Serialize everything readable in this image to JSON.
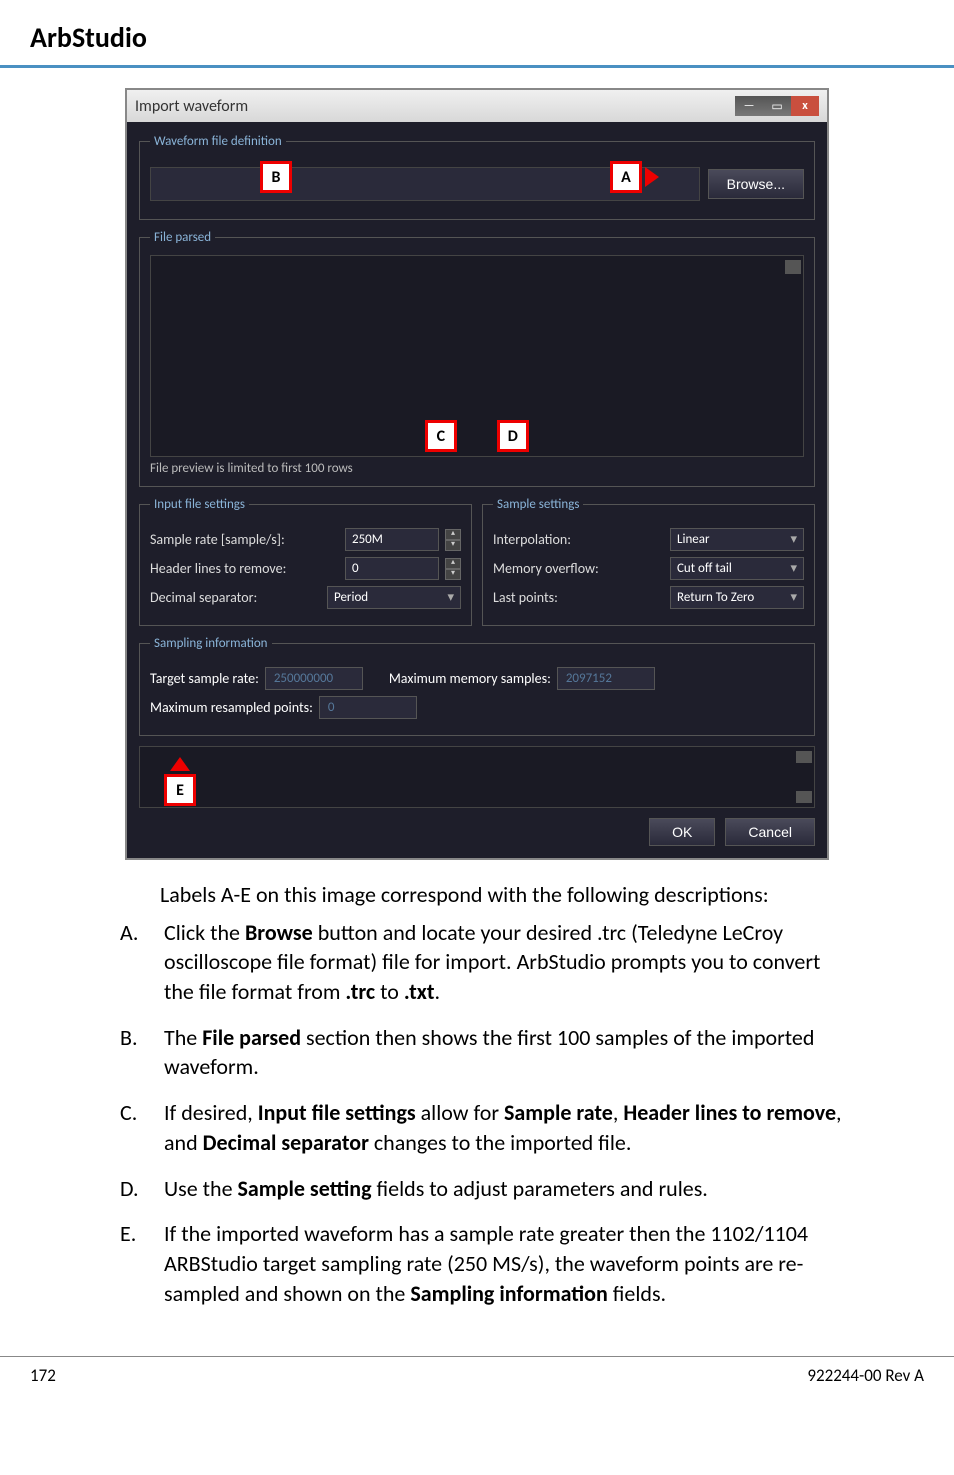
{
  "page_title": "ArbStudio",
  "window": {
    "title": "Import waveform",
    "close_x": "x"
  },
  "waveform_def": {
    "legend": "Waveform file definition",
    "browse": "Browse...",
    "marker_a": "A",
    "marker_b": "B"
  },
  "file_parsed": {
    "legend": "File parsed",
    "note": "File preview is limited to first 100 rows",
    "marker_c": "C",
    "marker_d": "D"
  },
  "input_settings": {
    "legend": "Input file settings",
    "sample_rate_label": "Sample rate [sample/s]:",
    "sample_rate_value": "250M",
    "header_lines_label": "Header lines to remove:",
    "header_lines_value": "0",
    "decimal_sep_label": "Decimal separator:",
    "decimal_sep_value": "Period"
  },
  "sample_settings": {
    "legend": "Sample settings",
    "interp_label": "Interpolation:",
    "interp_value": "Linear",
    "overflow_label": "Memory overflow:",
    "overflow_value": "Cut off tail",
    "lastpts_label": "Last points:",
    "lastpts_value": "Return To Zero"
  },
  "sampling_info": {
    "legend": "Sampling information",
    "target_rate_label": "Target sample rate:",
    "target_rate_value": "250000000",
    "max_mem_label": "Maximum memory samples:",
    "max_mem_value": "2097152",
    "max_resampled_label": "Maximum resampled points:",
    "max_resampled_value": "0"
  },
  "marker_e": "E",
  "ok": "OK",
  "cancel": "Cancel",
  "caption": "Labels A-E on this image correspond with the following descriptions:",
  "items": {
    "a_letter": "A.",
    "a_pre": "Click the ",
    "a_bold": "Browse",
    "a_post": " button and locate your desired .trc (Teledyne LeCroy oscilloscope file format) file for import. ArbStudio prompts you to convert the file format from ",
    "a_b1": ".trc",
    "a_mid": " to ",
    "a_b2": ".txt",
    "a_end": ".",
    "b_letter": "B.",
    "b_pre": "The ",
    "b_bold": "File parsed",
    "b_post": " section then shows the first 100 samples of the imported waveform.",
    "c_letter": "C.",
    "c_pre": "If desired, ",
    "c_b1": "Input file settings",
    "c_mid1": " allow for ",
    "c_b2": "Sample rate",
    "c_mid2": ", ",
    "c_b3": "Header lines to remove",
    "c_mid3": ", and ",
    "c_b4": "Decimal separator",
    "c_post": " changes to the imported file.",
    "d_letter": "D.",
    "d_pre": " Use the ",
    "d_bold": "Sample setting",
    "d_post": " fields to adjust parameters and rules.",
    "e_letter": "E.",
    "e_pre": " If the imported waveform has a sample rate greater then the 1102/1104 ARBStudio target sampling rate (250 MS/s), the waveform points are re-sampled and shown on the ",
    "e_bold": "Sampling information",
    "e_post": " fields."
  },
  "footer": {
    "page": "172",
    "doc": "922244-00 Rev A"
  }
}
